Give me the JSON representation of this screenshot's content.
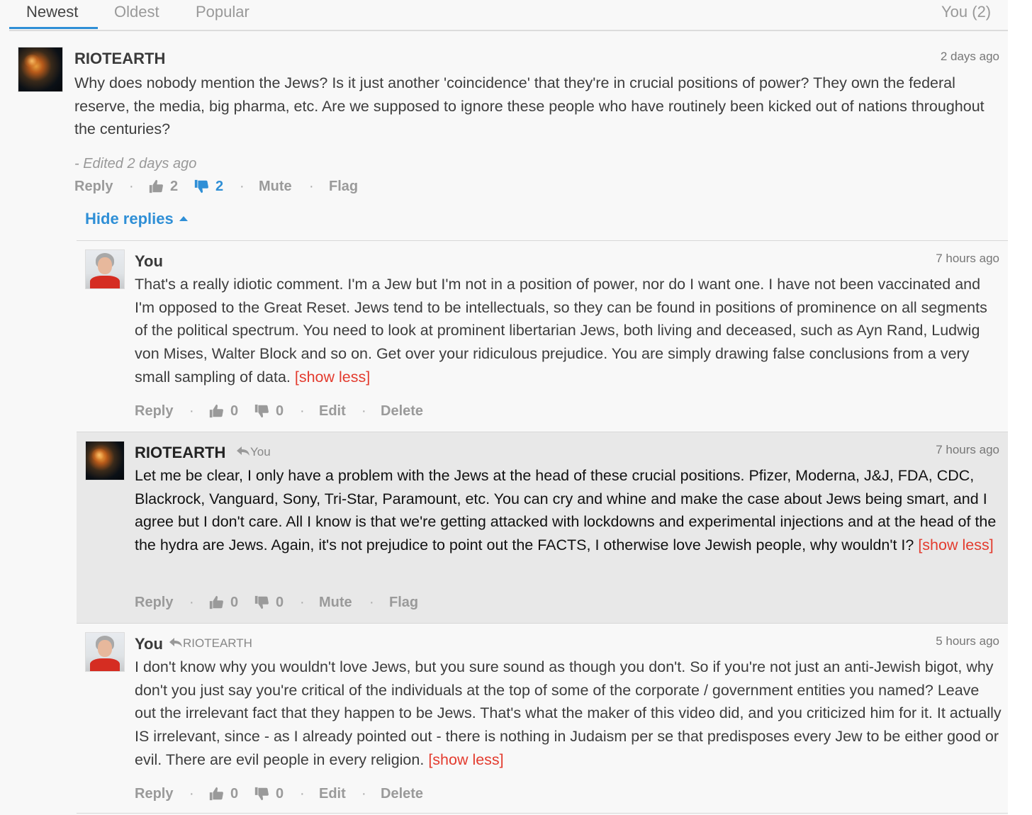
{
  "tabs": {
    "newest": "Newest",
    "oldest": "Oldest",
    "popular": "Popular",
    "you": "You (2)"
  },
  "colors": {
    "accent": "#2f8fd6",
    "show_less": "#e33b2e",
    "highlight_bg": "#e8e8e8"
  },
  "comment1": {
    "author": "RIOTEARTH",
    "time": "2 days ago",
    "avatar": "earth-avatar",
    "body": "Why does nobody mention the Jews? Is it just another 'coincidence' that they're in crucial positions of power? They own the federal reserve, the media, big pharma, etc. Are we supposed to ignore these people who have routinely been kicked out of nations throughout the centuries?",
    "edited": "- Edited 2 days ago",
    "reply": "Reply",
    "likes": "2",
    "dislikes": "2",
    "mute": "Mute",
    "flag": "Flag",
    "hide_replies": "Hide replies"
  },
  "reply1": {
    "author": "You",
    "time": "7 hours ago",
    "avatar": "user-avatar",
    "body": "That's a really idiotic comment. I'm a Jew but I'm not in a position of power, nor do I want one. I have not been vaccinated and I'm opposed to the Great Reset. Jews tend to be intellectuals, so they can be found in positions of prominence on all segments of the political spectrum. You need to look at prominent libertarian Jews, both living and deceased, such as Ayn Rand, Ludwig von Mises, Walter Block and so on. Get over your ridiculous prejudice. You are simply drawing false conclusions from a very small sampling of data.",
    "show_less": "[show less]",
    "reply": "Reply",
    "likes": "0",
    "dislikes": "0",
    "edit": "Edit",
    "delete": "Delete"
  },
  "reply2": {
    "author": "RIOTEARTH",
    "reply_to": "You",
    "time": "7 hours ago",
    "avatar": "earth-avatar",
    "body": "Let me be clear, I only have a problem with the Jews at the head of these crucial positions. Pfizer, Moderna, J&J, FDA, CDC, Blackrock, Vanguard, Sony, Tri-Star, Paramount, etc. You can cry and whine and make the case about Jews being smart, and I agree but I don't care. All I know is that we're getting attacked with lockdowns and experimental injections and at the head of the the hydra are Jews. Again, it's not prejudice to point out the FACTS, I otherwise love Jewish people, why wouldn't I?",
    "show_less": "[show less]",
    "reply": "Reply",
    "likes": "0",
    "dislikes": "0",
    "mute": "Mute",
    "flag": "Flag"
  },
  "reply3": {
    "author": "You",
    "reply_to": "RIOTEARTH",
    "time": "5 hours ago",
    "avatar": "user-avatar",
    "body": "I don't know why you wouldn't love Jews, but you sure sound as though you don't. So if you're not just an anti-Jewish bigot, why don't you just say you're critical of the individuals at the top of some of the corporate / government entities you named? Leave out the irrelevant fact that they happen to be Jews. That's what the maker of this video did, and you criticized him for it. It actually IS irrelevant, since - as I already pointed out - there is nothing in Judaism per se that predisposes every Jew to be either good or evil. There are evil people in every religion.",
    "show_less": "[show less]",
    "reply": "Reply",
    "likes": "0",
    "dislikes": "0",
    "edit": "Edit",
    "delete": "Delete"
  }
}
